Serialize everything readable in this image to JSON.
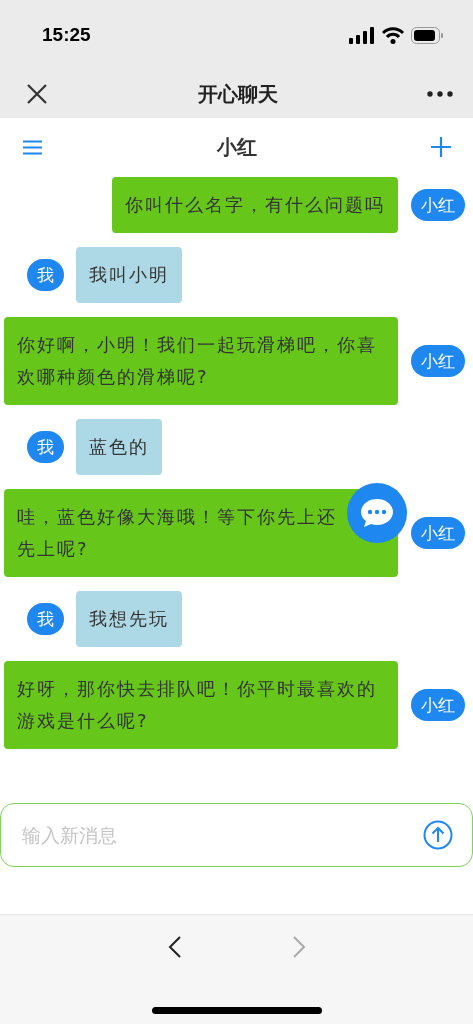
{
  "status_bar": {
    "time": "15:25"
  },
  "nav_bar": {
    "title": "开心聊天"
  },
  "chat_header": {
    "title": "小红"
  },
  "messages": [
    {
      "kind": "partner",
      "sender": "小红",
      "text": "你叫什么名字，有什么问题吗"
    },
    {
      "kind": "me",
      "sender": "我",
      "text": "我叫小明"
    },
    {
      "kind": "partner",
      "sender": "小红",
      "text": "你好啊，小明！我们一起玩滑梯吧，你喜欢哪种颜色的滑梯呢?"
    },
    {
      "kind": "me",
      "sender": "我",
      "text": "蓝色的"
    },
    {
      "kind": "partner",
      "sender": "小红",
      "lines": [
        "哇，蓝色好像大海哦！等下你先上还",
        "先上呢?"
      ]
    },
    {
      "kind": "me",
      "sender": "我",
      "text": "我想先玩"
    },
    {
      "kind": "partner",
      "sender": "小红",
      "text": "好呀，那你快去排队吧！你平时最喜欢的游戏是什么呢?"
    }
  ],
  "composer": {
    "placeholder": "输入新消息"
  }
}
